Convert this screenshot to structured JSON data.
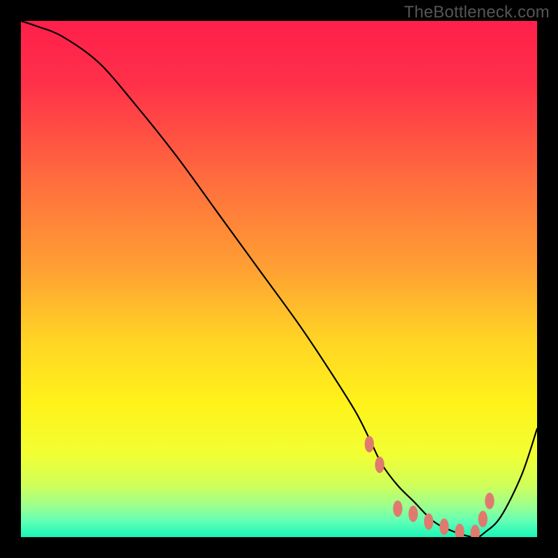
{
  "watermark": "TheBottleneck.com",
  "colors": {
    "gradient_stops": [
      {
        "offset": 0.0,
        "color": "#ff1f4b"
      },
      {
        "offset": 0.12,
        "color": "#ff3049"
      },
      {
        "offset": 0.3,
        "color": "#ff6a3e"
      },
      {
        "offset": 0.48,
        "color": "#ffa033"
      },
      {
        "offset": 0.62,
        "color": "#ffd524"
      },
      {
        "offset": 0.74,
        "color": "#fff21a"
      },
      {
        "offset": 0.84,
        "color": "#f1ff33"
      },
      {
        "offset": 0.9,
        "color": "#cfff5a"
      },
      {
        "offset": 0.94,
        "color": "#9cff8e"
      },
      {
        "offset": 0.97,
        "color": "#5fffb6"
      },
      {
        "offset": 1.0,
        "color": "#18f7b8"
      }
    ],
    "curve": "#000000",
    "markers": "#e07a6e",
    "background": "#000000"
  },
  "chart_data": {
    "type": "line",
    "title": "",
    "xlabel": "",
    "ylabel": "",
    "xlim": [
      0,
      100
    ],
    "ylim": [
      0,
      100
    ],
    "grid": false,
    "series": [
      {
        "name": "bottleneck-curve",
        "x": [
          0,
          3,
          8,
          15,
          22,
          30,
          38,
          46,
          54,
          60,
          65,
          68,
          70,
          73,
          76,
          80,
          84,
          88,
          90,
          93,
          97,
          100
        ],
        "values": [
          100,
          99,
          97,
          92,
          84,
          74,
          63,
          52,
          41,
          32,
          24,
          18,
          14,
          10,
          7,
          3,
          1,
          0,
          1,
          4,
          12,
          21
        ]
      }
    ],
    "markers": {
      "name": "highlight-points",
      "x": [
        67.5,
        69.5,
        73.0,
        76.0,
        79.0,
        82.0,
        85.0,
        88.0,
        89.5,
        90.8
      ],
      "values": [
        18.0,
        14.0,
        5.5,
        4.5,
        3.0,
        2.0,
        1.0,
        0.8,
        3.5,
        7.0
      ],
      "rx": 0.9,
      "ry": 1.6
    }
  }
}
